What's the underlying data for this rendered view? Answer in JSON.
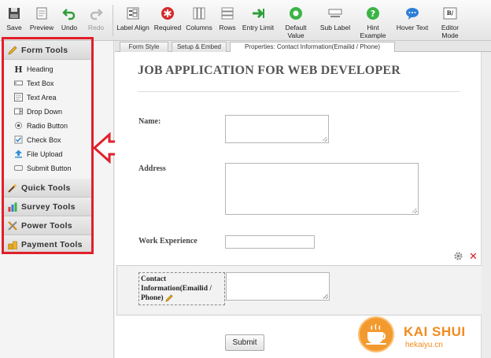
{
  "toolbar": {
    "save": "Save",
    "preview": "Preview",
    "undo": "Undo",
    "redo": "Redo",
    "label_align": "Label Align",
    "required": "Required",
    "columns": "Columns",
    "rows": "Rows",
    "entry_limit": "Entry Limit",
    "default_value": "Default Value",
    "sub_label": "Sub Label",
    "hint_example": "Hint Example",
    "hover_text": "Hover Text",
    "editor_mode": "Editor Mode",
    "editor_mode_glyph": "B/"
  },
  "sidebar": {
    "categories": [
      {
        "label": "Form Tools",
        "icon": "pencil-icon"
      },
      {
        "label": "Quick Tools",
        "icon": "wand-icon"
      },
      {
        "label": "Survey Tools",
        "icon": "bar-chart-icon"
      },
      {
        "label": "Power Tools",
        "icon": "tools-icon"
      },
      {
        "label": "Payment Tools",
        "icon": "coins-icon"
      }
    ],
    "form_tools": [
      {
        "label": "Heading",
        "icon": "heading-icon"
      },
      {
        "label": "Text Box",
        "icon": "textbox-icon"
      },
      {
        "label": "Text Area",
        "icon": "textarea-icon"
      },
      {
        "label": "Drop Down",
        "icon": "dropdown-icon"
      },
      {
        "label": "Radio Button",
        "icon": "radio-icon"
      },
      {
        "label": "Check Box",
        "icon": "checkbox-icon"
      },
      {
        "label": "File Upload",
        "icon": "upload-icon"
      },
      {
        "label": "Submit Button",
        "icon": "submit-icon"
      }
    ]
  },
  "tabs": {
    "form_style": "Form Style",
    "setup_embed": "Setup & Embed",
    "properties": "Properties: Contact Information(Emailid / Phone)"
  },
  "form": {
    "title": "JOB APPLICATION FOR WEB DEVELOPER",
    "fields": {
      "name": "Name:",
      "address": "Address",
      "work_experience": "Work Experience",
      "contact": "Contact Information(Emailid / Phone)"
    },
    "submit": "Submit"
  },
  "watermark": {
    "brand": "KAI SHUI",
    "site": "hekaiyu.cn"
  },
  "colors": {
    "highlight_red": "#e0202a",
    "watermark_orange": "#f28b1e"
  }
}
